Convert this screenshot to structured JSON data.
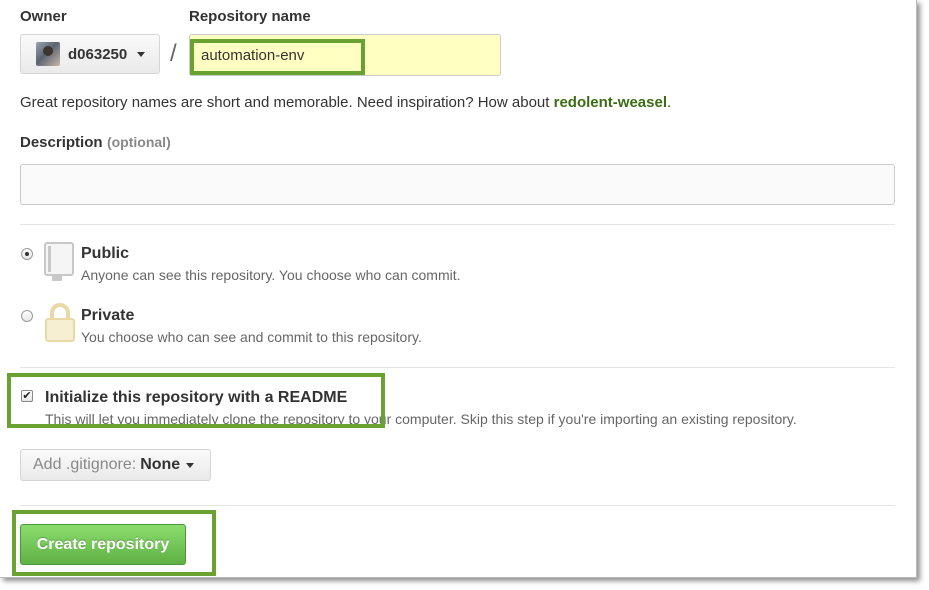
{
  "owner": {
    "label": "Owner",
    "value": "d063250"
  },
  "repository": {
    "label": "Repository name",
    "value": "automation-env",
    "separator": "/"
  },
  "hint": {
    "text": "Great repository names are short and memorable. Need inspiration? How about ",
    "suggestion": "redolent-weasel",
    "suffix": "."
  },
  "description": {
    "label": "Description",
    "optional": "(optional)",
    "value": ""
  },
  "visibility": {
    "selected": "public",
    "options": [
      {
        "id": "public",
        "title": "Public",
        "subtitle": "Anyone can see this repository. You choose who can commit.",
        "icon": "repo-book-icon"
      },
      {
        "id": "private",
        "title": "Private",
        "subtitle": "You choose who can see and commit to this repository.",
        "icon": "lock-icon"
      }
    ]
  },
  "readme": {
    "checked": true,
    "title": "Initialize this repository with a README",
    "subtitle": "This will let you immediately clone the repository to your computer. Skip this step if you're importing an existing repository."
  },
  "gitignore": {
    "prefix": "Add .gitignore:",
    "value": "None"
  },
  "submit": {
    "label": "Create repository"
  },
  "colors": {
    "highlight": "#6aa232",
    "suggestion": "#3c6d15",
    "button": "#60b044",
    "repo_input_bg": "#ffffc2"
  }
}
